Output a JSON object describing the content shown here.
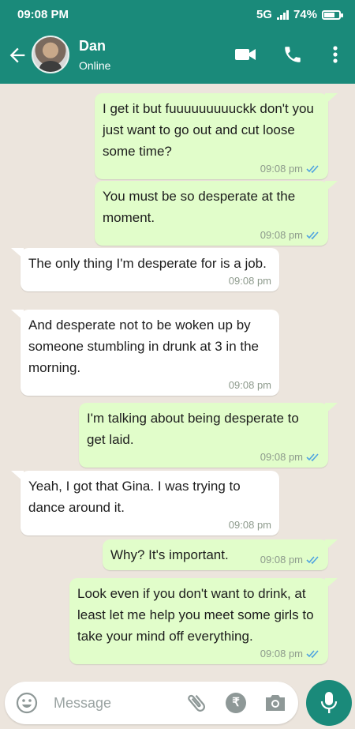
{
  "status": {
    "time": "09:08 PM",
    "network": "5G",
    "battery": "74%",
    "battery_level": 0.74
  },
  "contact": {
    "name": "Dan",
    "presence": "Online"
  },
  "icons": {
    "back": "arrow-left-icon",
    "video": "video-camera-icon",
    "call": "phone-icon",
    "menu": "more-vertical-icon",
    "emoji": "emoji-icon",
    "attach": "paperclip-icon",
    "payment": "rupee-icon",
    "camera": "camera-icon",
    "mic": "microphone-icon"
  },
  "colors": {
    "header": "#1a8a7a",
    "outgoing": "#e1fdca",
    "incoming": "#ffffff",
    "background": "#ece5dd",
    "read_ticks": "#4fa3e0"
  },
  "messages": [
    {
      "direction": "out",
      "text": "I get it but fuuuuuuuuuckk don't you just want to go out and cut loose some time?",
      "time": "09:08 pm"
    },
    {
      "direction": "out",
      "text": "You must be so desperate at the moment.",
      "time": "09:08 pm"
    },
    {
      "direction": "in",
      "text": "The only thing I'm desperate for is a job.",
      "time": "09:08 pm"
    },
    {
      "direction": "in",
      "text": "And desperate not to be woken up by someone stumbling in drunk at 3 in the morning.",
      "time": "09:08 pm"
    },
    {
      "direction": "out",
      "text": "I'm talking about being desperate to get laid.",
      "time": "09:08 pm"
    },
    {
      "direction": "in",
      "text": "Yeah, I got that Gina. I was trying to dance around it.",
      "time": "09:08 pm"
    },
    {
      "direction": "out",
      "text": "Why? It's important.",
      "time": "09:08 pm"
    },
    {
      "direction": "out",
      "text": "Look even if you don't want to drink, at least let me help you meet some girls to take your mind off everything.",
      "time": "09:08 pm"
    }
  ],
  "composer": {
    "placeholder": "Message",
    "rupee_symbol": "₹"
  }
}
